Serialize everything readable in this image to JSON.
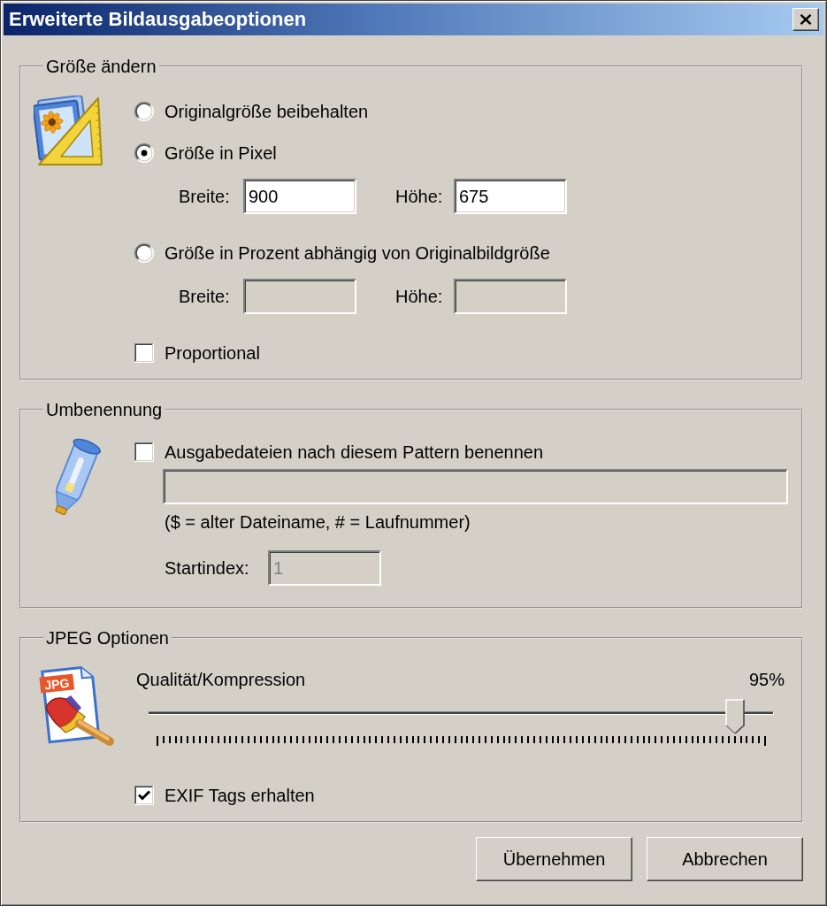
{
  "window": {
    "title": "Erweiterte Bildausgabeoptionen"
  },
  "resize": {
    "title": "Größe ändern",
    "options": [
      {
        "label": "Originalgröße beibehalten",
        "selected": false
      },
      {
        "label": "Größe in Pixel",
        "selected": true,
        "fields": [
          {
            "label": "Breite:",
            "value": "900",
            "disabled": false
          },
          {
            "label": "Höhe:",
            "value": "675",
            "disabled": false
          }
        ]
      },
      {
        "label": "Größe in Prozent abhängig von Originalbildgröße",
        "selected": false,
        "fields": [
          {
            "label": "Breite:",
            "disabled": true
          },
          {
            "label": "Höhe:",
            "disabled": true
          }
        ]
      }
    ],
    "proportional": {
      "label": "Proportional",
      "checked": false
    }
  },
  "rename": {
    "title": "Umbenennung",
    "pattern": {
      "label": "Ausgabedateien nach diesem Pattern benennen",
      "checked": false
    },
    "pattern_field": {
      "disabled": true
    },
    "hint": "($ = alter Dateiname, # = Laufnummer)",
    "start_index": {
      "label": "Startindex:",
      "value": "1",
      "disabled": true
    }
  },
  "jpeg": {
    "title": "JPEG Optionen",
    "icon_label": "JPG",
    "quality": {
      "label": "Qualität/Kompression",
      "reading": "95%",
      "level": 0.95
    },
    "exif": {
      "label": "EXIF Tags erhalten",
      "checked": true
    }
  },
  "buttons": [
    "Übernehmen",
    "Abbrechen"
  ]
}
